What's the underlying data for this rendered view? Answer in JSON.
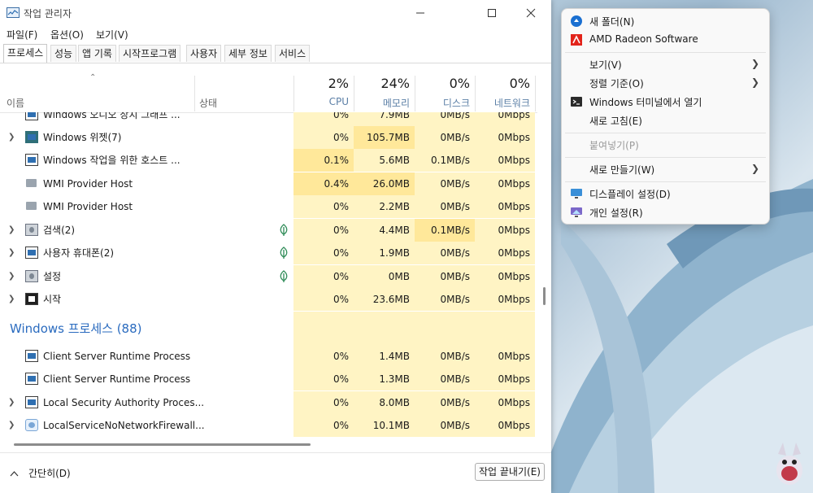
{
  "window": {
    "title": "작업 관리자"
  },
  "menu": [
    "파일(F)",
    "옵션(O)",
    "보기(V)"
  ],
  "tabs": [
    "프로세스",
    "성능",
    "앱 기록",
    "시작프로그램",
    "사용자",
    "세부 정보",
    "서비스"
  ],
  "columns": {
    "name": "이름",
    "status": "상태",
    "cpu": {
      "pct": "2%",
      "label": "CPU"
    },
    "memory": {
      "pct": "24%",
      "label": "메모리"
    },
    "disk": {
      "pct": "0%",
      "label": "디스크"
    },
    "network": {
      "pct": "0%",
      "label": "네트워크"
    }
  },
  "rows": [
    {
      "name": "Windows 오디오 장치 그래프 ...",
      "cpu": "0%",
      "mem": "7.9MB",
      "disk": "0MB/s",
      "net": "0Mbps",
      "expand": false,
      "icon": "app-icon",
      "leaf": false
    },
    {
      "name": "Windows 위젯(7)",
      "cpu": "0%",
      "mem": "105.7MB",
      "disk": "0MB/s",
      "net": "0Mbps",
      "expand": true,
      "icon": "widgets-icon",
      "leaf": false
    },
    {
      "name": "Windows 작업을 위한 호스트 ...",
      "cpu": "0.1%",
      "mem": "5.6MB",
      "disk": "0.1MB/s",
      "net": "0Mbps",
      "expand": false,
      "icon": "app-icon",
      "leaf": false
    },
    {
      "name": "WMI Provider Host",
      "cpu": "0.4%",
      "mem": "26.0MB",
      "disk": "0MB/s",
      "net": "0Mbps",
      "expand": false,
      "icon": "host-icon",
      "leaf": false
    },
    {
      "name": "WMI Provider Host",
      "cpu": "0%",
      "mem": "2.2MB",
      "disk": "0MB/s",
      "net": "0Mbps",
      "expand": false,
      "icon": "host-icon",
      "leaf": false
    },
    {
      "name": "검색(2)",
      "cpu": "0%",
      "mem": "4.4MB",
      "disk": "0.1MB/s",
      "net": "0Mbps",
      "expand": true,
      "icon": "search-app-icon",
      "leaf": true
    },
    {
      "name": "사용자 휴대폰(2)",
      "cpu": "0%",
      "mem": "1.9MB",
      "disk": "0MB/s",
      "net": "0Mbps",
      "expand": true,
      "icon": "app-icon",
      "leaf": true
    },
    {
      "name": "설정",
      "cpu": "0%",
      "mem": "0MB",
      "disk": "0MB/s",
      "net": "0Mbps",
      "expand": true,
      "icon": "settings-icon",
      "leaf": true
    },
    {
      "name": "시작",
      "cpu": "0%",
      "mem": "23.6MB",
      "disk": "0MB/s",
      "net": "0Mbps",
      "expand": true,
      "icon": "start-icon",
      "leaf": false
    }
  ],
  "group": {
    "title": "Windows 프로세스 (88)"
  },
  "group_rows": [
    {
      "name": "Client Server Runtime Process",
      "cpu": "0%",
      "mem": "1.4MB",
      "disk": "0MB/s",
      "net": "0Mbps",
      "expand": false
    },
    {
      "name": "Client Server Runtime Process",
      "cpu": "0%",
      "mem": "1.3MB",
      "disk": "0MB/s",
      "net": "0Mbps",
      "expand": false
    },
    {
      "name": "Local Security Authority Proces...",
      "cpu": "0%",
      "mem": "8.0MB",
      "disk": "0MB/s",
      "net": "0Mbps",
      "expand": true
    },
    {
      "name": "LocalServiceNoNetworkFirewall...",
      "cpu": "0%",
      "mem": "10.1MB",
      "disk": "0MB/s",
      "net": "0Mbps",
      "expand": true
    }
  ],
  "footer": {
    "fewer": "간단히(D)",
    "end_task": "작업 끝내기(E)"
  },
  "context_menu": {
    "items": [
      {
        "label": "새 폴더(N)",
        "icon": "new-folder-icon"
      },
      {
        "label": "AMD Radeon Software",
        "icon": "amd-icon"
      },
      {
        "label": "보기(V)",
        "submenu": true
      },
      {
        "label": "정렬 기준(O)",
        "submenu": true
      },
      {
        "label": "Windows 터미널에서 열기",
        "icon": "terminal-icon"
      },
      {
        "label": "새로 고침(E)"
      },
      {
        "label": "붙여넣기(P)",
        "disabled": true
      },
      {
        "label": "새로 만들기(W)",
        "submenu": true
      },
      {
        "label": "디스플레이 설정(D)",
        "icon": "display-icon"
      },
      {
        "label": "개인 설정(R)",
        "icon": "personalize-icon"
      }
    ]
  },
  "colors": {
    "accent": "#2a6bbf",
    "heat_light": "#fff4c4",
    "heat_medium": "#ffe89a"
  }
}
